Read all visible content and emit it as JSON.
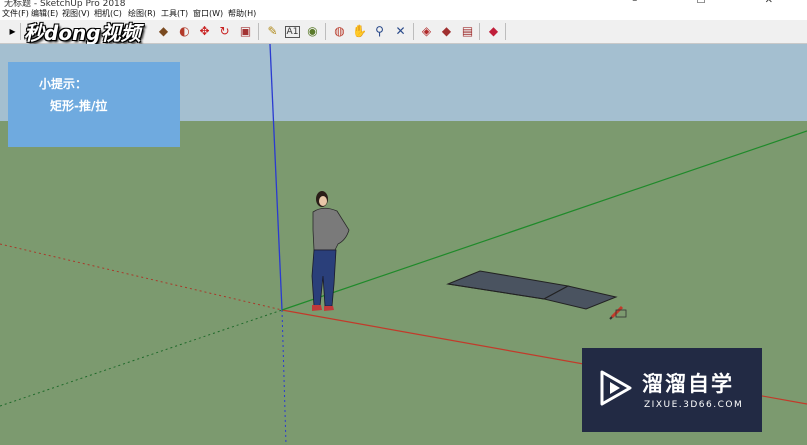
{
  "window": {
    "title": "无标题 - SketchUp Pro 2018",
    "controls": "–  ☐  ✕"
  },
  "menu": [
    "文件(F)",
    "编辑(E)",
    "视图(V)",
    "相机(C)",
    "绘图(R)",
    "工具(T)",
    "窗口(W)",
    "帮助(H)"
  ],
  "toolbar": {
    "tools": [
      {
        "name": "select-tool-icon",
        "glyph": "▸",
        "color": "#111111"
      },
      {
        "name": "paint-bucket-tool-icon",
        "glyph": "◆",
        "color": "#7a4a20"
      },
      {
        "name": "push-pull-tool-icon",
        "glyph": "▲",
        "color": "#b23a2a"
      },
      {
        "name": "follow-me-tool-icon",
        "glyph": "◐",
        "color": "#b23a2a"
      },
      {
        "name": "move-tool-icon",
        "glyph": "✥",
        "color": "#c81e1e"
      },
      {
        "name": "rotate-tool-icon",
        "glyph": "↻",
        "color": "#c81e1e"
      },
      {
        "name": "scale-tool-icon",
        "glyph": "▣",
        "color": "#a33333"
      },
      {
        "name": "tape-measure-tool-icon",
        "glyph": "✎",
        "color": "#b08a1a"
      },
      {
        "name": "text-tool-icon",
        "glyph": "A",
        "color": "#333333"
      },
      {
        "name": "paint-tool-icon",
        "glyph": "◉",
        "color": "#5a7a2a"
      },
      {
        "name": "orbit-tool-icon",
        "glyph": "◍",
        "color": "#b83a2a"
      },
      {
        "name": "pan-tool-icon",
        "glyph": "✋",
        "color": "#c8a040"
      },
      {
        "name": "zoom-tool-icon",
        "glyph": "⚲",
        "color": "#2a4a8a"
      },
      {
        "name": "zoom-extents-tool-icon",
        "glyph": "✕",
        "color": "#2a4a8a"
      },
      {
        "name": "warehouse-icon",
        "glyph": "◈",
        "color": "#b02a2a"
      },
      {
        "name": "components-icon",
        "glyph": "◆",
        "color": "#a03030"
      },
      {
        "name": "extension-warehouse-icon",
        "glyph": "▤",
        "color": "#a03030"
      },
      {
        "name": "ruby-console-icon",
        "glyph": "◆",
        "color": "#c01e3a"
      }
    ]
  },
  "logo": {
    "text": "秒dong视频"
  },
  "tip": {
    "line1": "小提示：",
    "line2": "矩形-推/拉"
  },
  "watermark": {
    "cn": "溜溜自学",
    "en": "ZIXUE.3D66.COM"
  },
  "colors": {
    "sky": "#a4bfd0",
    "ground": "#7c9a6f",
    "red_axis": "#c23a2a",
    "green_axis": "#1f8a2a",
    "blue_axis": "#2a3ad0",
    "face": "#4a5360"
  }
}
